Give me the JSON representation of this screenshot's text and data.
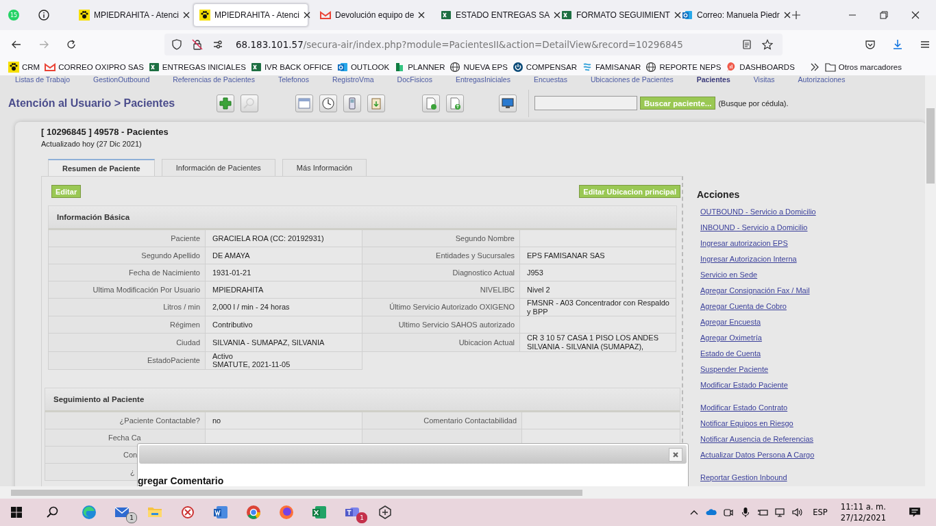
{
  "browser": {
    "whatsapp_badge": "15",
    "tabs": [
      {
        "title": "MPIEDRAHITA - Atenci",
        "selected": false,
        "kind": "paw"
      },
      {
        "title": "MPIEDRAHITA - Atenci",
        "selected": true,
        "kind": "paw"
      },
      {
        "title": "Devolución equipo de",
        "selected": false,
        "kind": "gmail"
      },
      {
        "title": "ESTADO ENTREGAS SA",
        "selected": false,
        "kind": "excel"
      },
      {
        "title": "FORMATO SEGUIMIENT",
        "selected": false,
        "kind": "excel"
      },
      {
        "title": "Correo: Manuela Piedr",
        "selected": false,
        "kind": "outlook"
      }
    ],
    "url_host": "68.183.101.57",
    "url_path": "/secura-air/index.php?module=PacientesII&action=DetailView&record=10296845",
    "bookmarks": [
      {
        "label": "CRM",
        "kind": "paw"
      },
      {
        "label": "CORREO OXIPRO SAS",
        "kind": "gmail"
      },
      {
        "label": "ENTREGAS INICIALES",
        "kind": "excel"
      },
      {
        "label": "IVR BACK OFFICE",
        "kind": "excel"
      },
      {
        "label": "OUTLOOK",
        "kind": "outlook"
      },
      {
        "label": "PLANNER",
        "kind": "planner"
      },
      {
        "label": "NUEVA EPS",
        "kind": "globe"
      },
      {
        "label": "COMPENSAR",
        "kind": "power"
      },
      {
        "label": "FAMISANAR",
        "kind": "famisanar"
      },
      {
        "label": "REPORTE NEPS",
        "kind": "globe"
      },
      {
        "label": "DASHBOARDS",
        "kind": "dashboards"
      }
    ],
    "other_bookmarks": "Otros marcadores"
  },
  "nav": [
    {
      "label": "Listas de Trabajo",
      "selected": false
    },
    {
      "label": "GestionOutbound",
      "selected": false
    },
    {
      "label": "Referencias de Pacientes",
      "selected": false
    },
    {
      "label": "Telefonos",
      "selected": false
    },
    {
      "label": "RegistroVma",
      "selected": false
    },
    {
      "label": "DocFisicos",
      "selected": false
    },
    {
      "label": "EntregasIniciales",
      "selected": false
    },
    {
      "label": "Encuestas",
      "selected": false
    },
    {
      "label": "Ubicaciones de Pacientes",
      "selected": false
    },
    {
      "label": "Pacientes",
      "selected": true
    },
    {
      "label": "Visitas",
      "selected": false
    },
    {
      "label": "Autorizaciones",
      "selected": false
    }
  ],
  "header": {
    "title": "Atención al Usuario > Pacientes",
    "search_button": "Buscar paciente...",
    "search_hint": "(Busque por cédula)."
  },
  "record": {
    "title": "[ 10296845 ] 49578 - Pacientes",
    "updated": "Actualizado hoy (27 Dic 2021)",
    "tabs": [
      {
        "label": "Resumen de Paciente",
        "selected": true
      },
      {
        "label": "Información de Pacientes",
        "selected": false
      },
      {
        "label": "Más Información",
        "selected": false
      }
    ],
    "edit_button": "Editar",
    "edit_location_button": "Editar Ubicacion principal"
  },
  "basic": {
    "title": "Información Básica",
    "rows": [
      {
        "label": "Paciente",
        "value": "GRACIELA ROA (CC: 20192931)",
        "label2": "Segundo Nombre",
        "value2": ""
      },
      {
        "label": "Segundo Apellido",
        "value": "DE AMAYA",
        "label2": "Entidades y Sucursales",
        "value2": "EPS FAMISANAR SAS"
      },
      {
        "label": "Fecha de Nacimiento",
        "value": "1931-01-21",
        "label2": "Diagnostico Actual",
        "value2": "J953"
      },
      {
        "label": "Ultima Modificación Por Usuario",
        "value": "MPIEDRAHITA",
        "label2": "NIVELIBC",
        "value2": "Nivel 2"
      },
      {
        "label": "Litros / min",
        "value": "2,000 l / min - 24 horas",
        "label2": "Último Servicio Autorizado OXIGENO",
        "value2": "FMSNR - A03 Concentrador con Respaldo\ny BPP"
      },
      {
        "label": "Régimen",
        "value": "Contributivo",
        "label2": "Ultimo Servicio SAHOS autorizado",
        "value2": ""
      },
      {
        "label": "Ciudad",
        "value": "SILVANIA - SUMAPAZ, SILVANIA",
        "label2": "Ubicacion Actual",
        "value2": "CR 3 10 57 CASA 1 PISO LOS ANDES\nSILVANIA - SILVANIA (SUMAPAZ),"
      },
      {
        "label": "EstadoPaciente",
        "value": "Activo\nSMATUTE, 2021-11-05"
      }
    ]
  },
  "followup": {
    "title": "Seguimiento al Paciente",
    "rows": [
      {
        "kind": "full",
        "label": "¿Paciente Contactable?",
        "value": "no",
        "label2": "Comentario Contactabilidad",
        "value2": ""
      },
      {
        "kind": "partial",
        "label": "Fecha Ca"
      },
      {
        "kind": "partial",
        "label": "Con"
      },
      {
        "kind": "partial",
        "label": "¿"
      }
    ]
  },
  "dialog": {
    "heading": "gregar Comentario"
  },
  "actions": {
    "title": "Acciones",
    "groups": [
      [
        "OUTBOUND - Servicio a Domicilio",
        "INBOUND - Servicio a Domicilio",
        "Ingresar autorizacion EPS",
        "Ingresar Autorizacion Interna",
        "Servicio en Sede",
        "Agregar Consignación Fax / Mail",
        "Agregar Cuenta de Cobro",
        "Agregar Encuesta",
        "Agregar Oximetría",
        "Estado de Cuenta",
        "Suspender Paciente",
        "Modificar Estado Paciente"
      ],
      [
        "Modificar Estado Contrato",
        "Notificar Equipos en Riesgo",
        "Notificar Ausencia de Referencias",
        "Actualizar Datos Persona A Cargo"
      ],
      [
        "Reportar Gestion Inbound"
      ]
    ]
  },
  "taskbar": {
    "apps": [
      {
        "kind": "edge"
      },
      {
        "kind": "mail",
        "badge": "1"
      },
      {
        "kind": "folder"
      },
      {
        "kind": "tool"
      },
      {
        "kind": "word"
      },
      {
        "kind": "chrome"
      },
      {
        "kind": "firefox"
      },
      {
        "kind": "excel"
      },
      {
        "kind": "teams",
        "badge": "1"
      },
      {
        "kind": "snip"
      }
    ],
    "language": "ESP",
    "time": "11:11 a. m.",
    "date": "27/12/2021"
  }
}
